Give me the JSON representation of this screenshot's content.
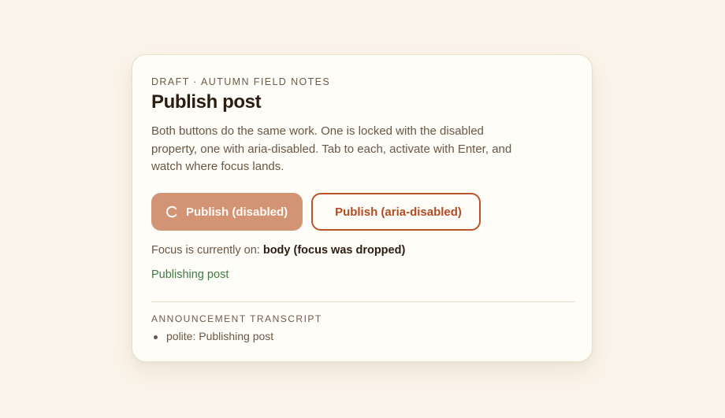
{
  "card": {
    "eyebrow": "DRAFT · AUTUMN FIELD NOTES",
    "title": "Publish post",
    "description": "Both buttons do the same work. One is locked with the disabled property, one with aria-disabled. Tab to each, activate with Enter, and watch where focus lands."
  },
  "buttons": {
    "disabled_label": "Publish (disabled)",
    "aria_label": "Publish (aria-disabled)"
  },
  "focus": {
    "prefix": "Focus is currently on:",
    "value": "body (focus was dropped)"
  },
  "status_message": "Publishing post",
  "transcript": {
    "heading": "ANNOUNCEMENT TRANSCRIPT",
    "items": [
      "polite: Publishing post"
    ]
  },
  "colors": {
    "background": "#fbf4ea",
    "card": "#fffdf7",
    "accent": "#b9532c",
    "disabled_fill": "#d29474",
    "status_green": "#3f7a43"
  },
  "icons": {
    "spinner": "loading-spinner-icon"
  }
}
